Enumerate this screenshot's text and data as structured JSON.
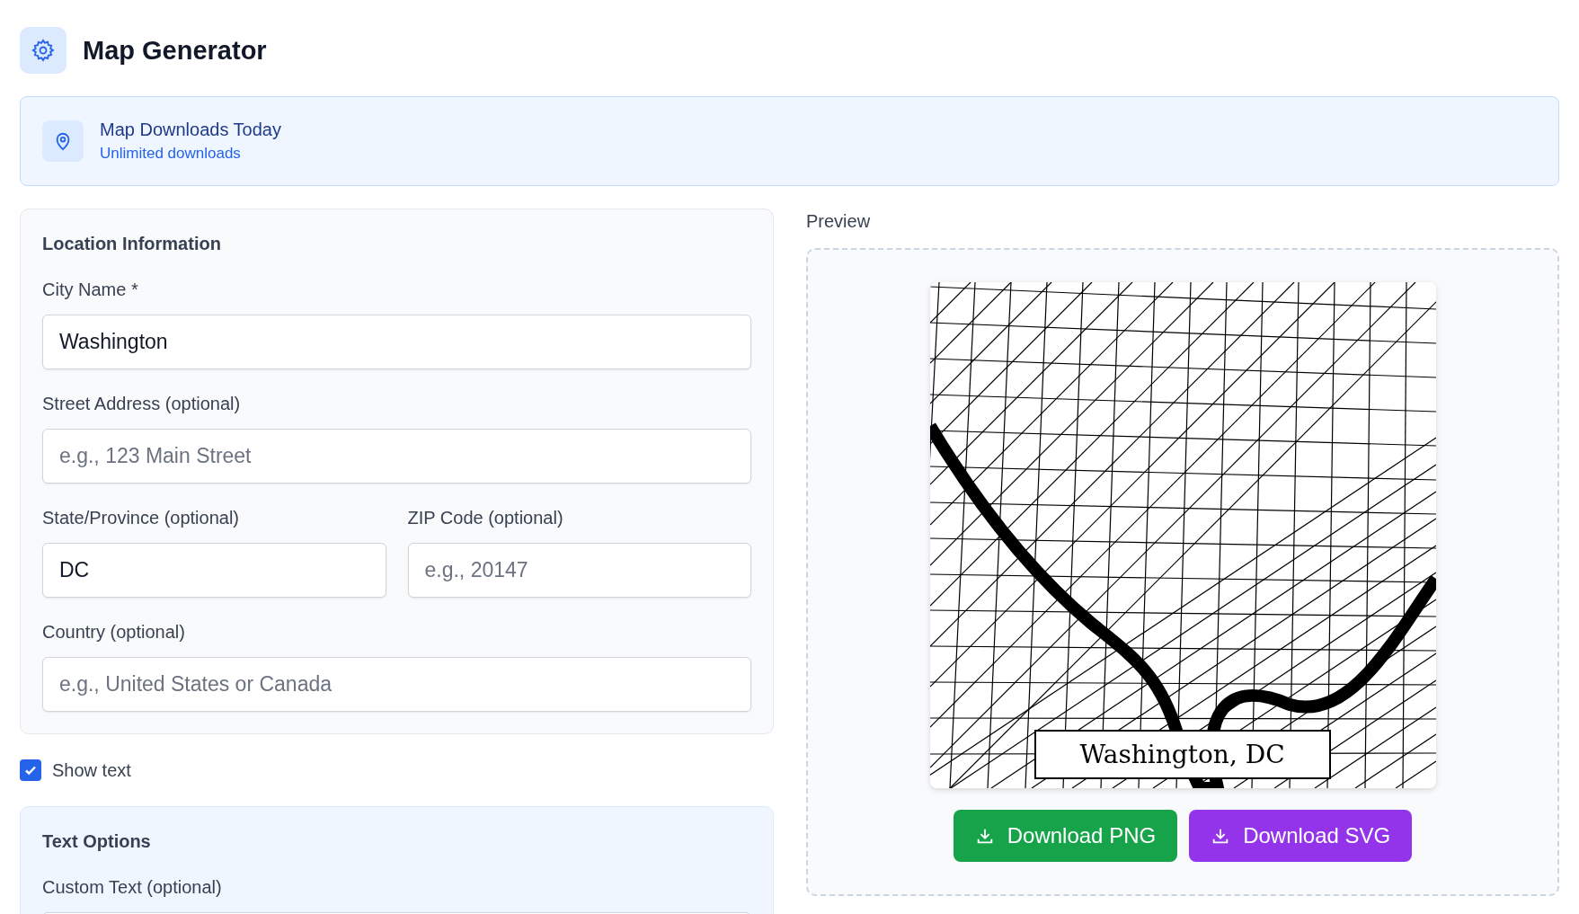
{
  "header": {
    "title": "Map Generator"
  },
  "banner": {
    "title": "Map Downloads Today",
    "subtitle": "Unlimited downloads"
  },
  "location": {
    "heading": "Location Information",
    "rows": [
      [
        {
          "label": "City Name *",
          "value": "Washington"
        }
      ],
      [
        {
          "label": "Street Address (optional)",
          "placeholder": "e.g., 123 Main Street"
        }
      ],
      [
        {
          "label": "State/Province (optional)",
          "value": "DC"
        },
        {
          "label": "ZIP Code (optional)",
          "placeholder": "e.g., 20147"
        }
      ],
      [
        {
          "label": "Country (optional)",
          "placeholder": "e.g., United States or Canada"
        }
      ]
    ]
  },
  "show_text": {
    "label": "Show text",
    "checked": true
  },
  "text_options": {
    "heading": "Text Options",
    "field_label": "Custom Text (optional)"
  },
  "preview": {
    "label": "Preview",
    "map_label": "Washington, DC",
    "buttons": [
      {
        "label": "Download PNG",
        "kind": "png"
      },
      {
        "label": "Download SVG",
        "kind": "svg"
      }
    ]
  }
}
